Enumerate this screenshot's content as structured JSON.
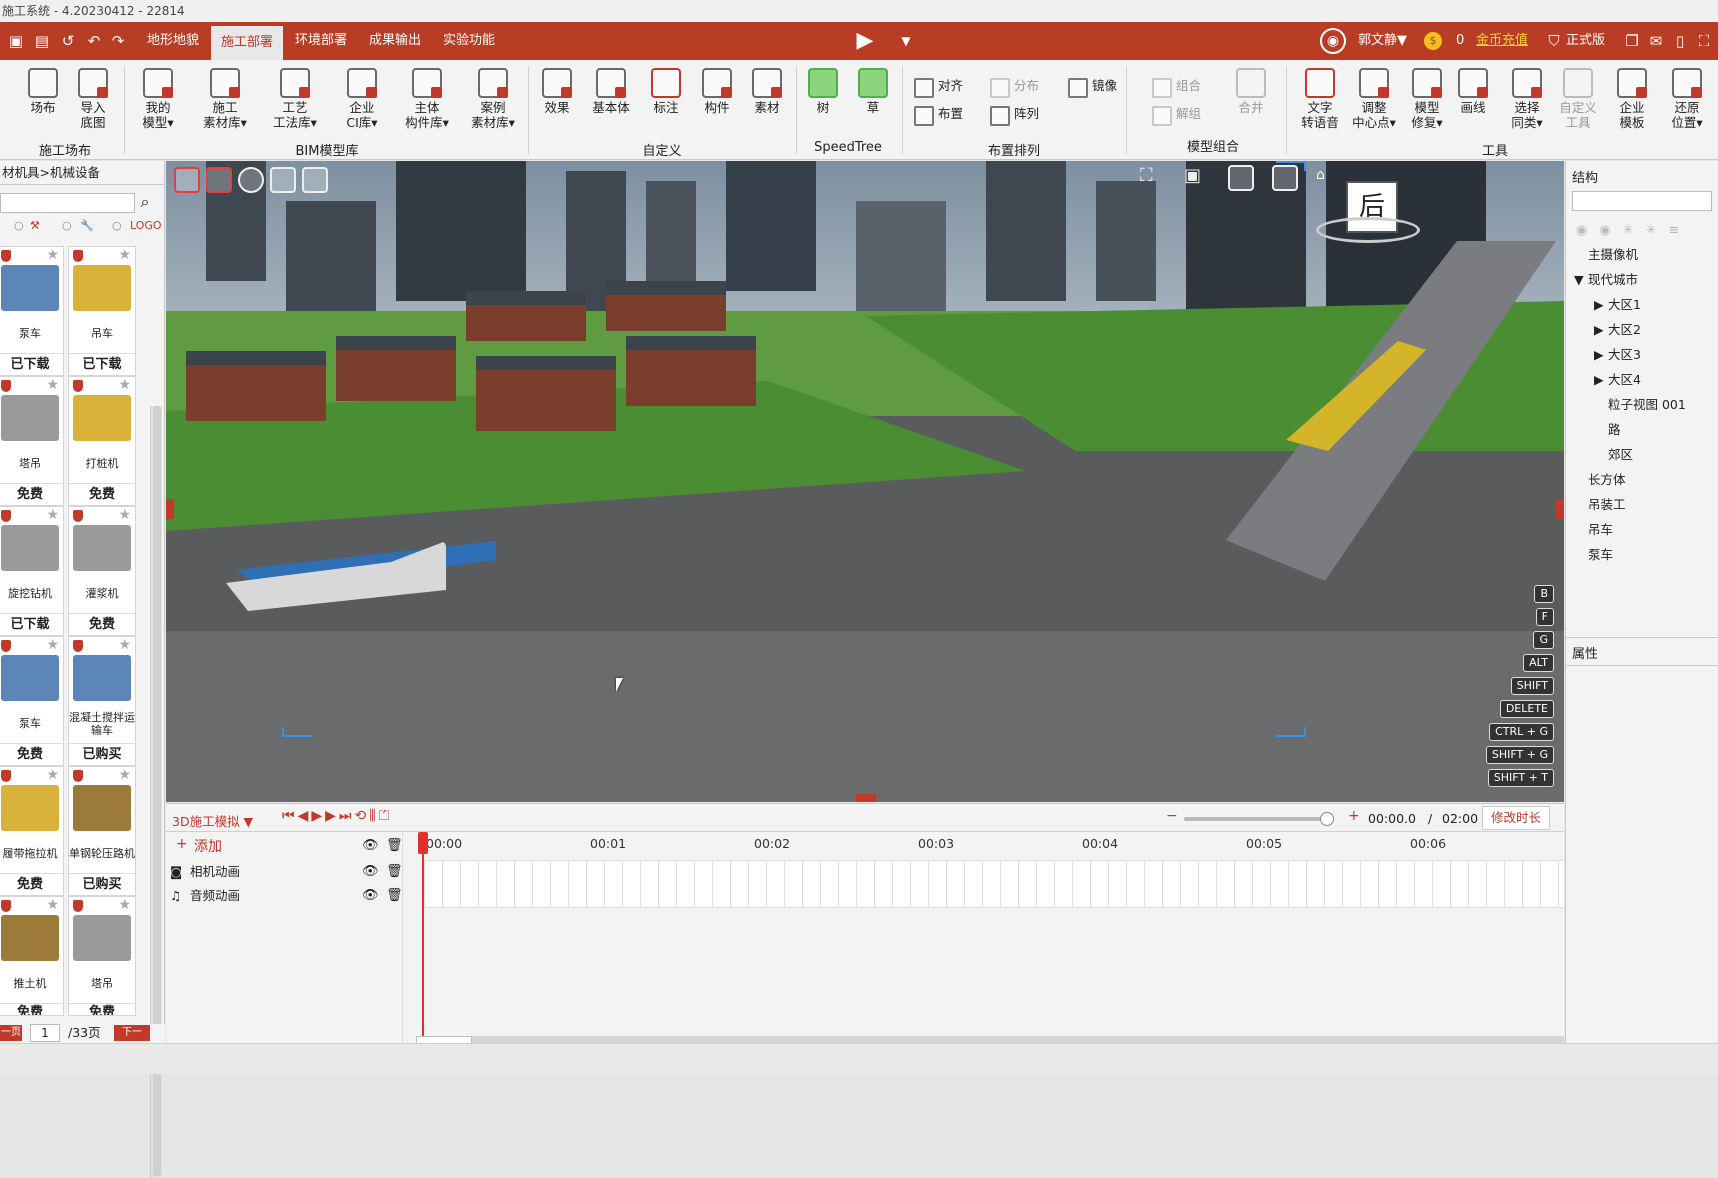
{
  "title": "施工系统 - 4.20230412 - 22814",
  "menu": {
    "tabs": [
      "地形地貌",
      "施工部署",
      "环境部署",
      "成果输出",
      "实验功能"
    ],
    "user": "郭文静▼",
    "coins": "0",
    "recharge": "金币充值",
    "edition": "正式版"
  },
  "ribbon": {
    "groups": {
      "site": "施工场布",
      "bim": "BIM模型库",
      "custom": "自定义",
      "speedtree": "SpeedTree",
      "layout": "布置排列",
      "combo": "模型组合",
      "tools": "工具"
    },
    "site_btns": [
      {
        "l1": "场布",
        "l2": ""
      },
      {
        "l1": "导入",
        "l2": "底图"
      }
    ],
    "bim_btns": [
      {
        "l1": "我的",
        "l2": "模型▾"
      },
      {
        "l1": "施工",
        "l2": "素材库▾"
      },
      {
        "l1": "工艺",
        "l2": "工法库▾"
      },
      {
        "l1": "企业",
        "l2": "CI库▾"
      },
      {
        "l1": "主体",
        "l2": "构件库▾"
      },
      {
        "l1": "案例",
        "l2": "素材库▾"
      }
    ],
    "custom_btns": [
      "效果",
      "基本体",
      "标注",
      "构件",
      "素材"
    ],
    "tree_btns": [
      "树",
      "草"
    ],
    "layout_btns": [
      "对齐",
      "分布",
      "镜像",
      "布置",
      "阵列"
    ],
    "combo_btns": [
      "组合",
      "解组",
      "合并"
    ],
    "tool_btns": [
      {
        "l1": "文字",
        "l2": "转语音"
      },
      {
        "l1": "调整",
        "l2": "中心点▾"
      },
      {
        "l1": "模型",
        "l2": "修复▾"
      },
      {
        "l1": "画线",
        "l2": ""
      },
      {
        "l1": "选择",
        "l2": "同类▾"
      },
      {
        "l1": "自定义",
        "l2": "工具"
      },
      {
        "l1": "企业",
        "l2": "模板"
      },
      {
        "l1": "还原",
        "l2": "位置▾"
      }
    ]
  },
  "left_panel": {
    "breadcrumb": "材机具>机械设备",
    "filter_logo": "LOGO",
    "items": [
      {
        "name": "泵车",
        "status": "已下载"
      },
      {
        "name": "吊车",
        "status": "已下载"
      },
      {
        "name": "塔吊",
        "status": "免费"
      },
      {
        "name": "打桩机",
        "status": "免费"
      },
      {
        "name": "旋挖钻机",
        "status": "已下载"
      },
      {
        "name": "灌浆机",
        "status": "免费"
      },
      {
        "name": "泵车",
        "status": "免费"
      },
      {
        "name": "混凝土搅拌运输车",
        "status": "已购买"
      },
      {
        "name": "履带拖拉机",
        "status": "免费"
      },
      {
        "name": "单钢轮压路机",
        "status": "已购买"
      },
      {
        "name": "推土机",
        "status": "免费"
      },
      {
        "name": "塔吊",
        "status": "免费"
      }
    ],
    "pager": {
      "prev": "一页",
      "page": "1",
      "total": "/33页",
      "next": "下一"
    }
  },
  "viewport": {
    "view_label": "后",
    "shortcuts": [
      "B",
      "F",
      "G",
      "ALT",
      "SHIFT",
      "DELETE",
      "CTRL + G",
      "SHIFT + G",
      "SHIFT + T"
    ]
  },
  "timeline": {
    "mode": "3D施工模拟 ▼",
    "add": "添加",
    "tracks": [
      "相机动画",
      "音频动画"
    ],
    "current": "00:00.0",
    "sep": "/",
    "duration": "02:00",
    "edit": "修改时长",
    "ticks": [
      "00:00",
      "00:01",
      "00:02",
      "00:03",
      "00:04",
      "00:05",
      "00:06"
    ],
    "zoom_level": 0.95
  },
  "right_panel": {
    "structure": "结构",
    "tree": [
      "主摄像机",
      "现代城市",
      "大区1",
      "大区2",
      "大区3",
      "大区4",
      "粒子视图 001",
      "路",
      "郊区",
      "长方体",
      "吊装工",
      "吊车",
      "泵车"
    ],
    "properties": "属性"
  }
}
